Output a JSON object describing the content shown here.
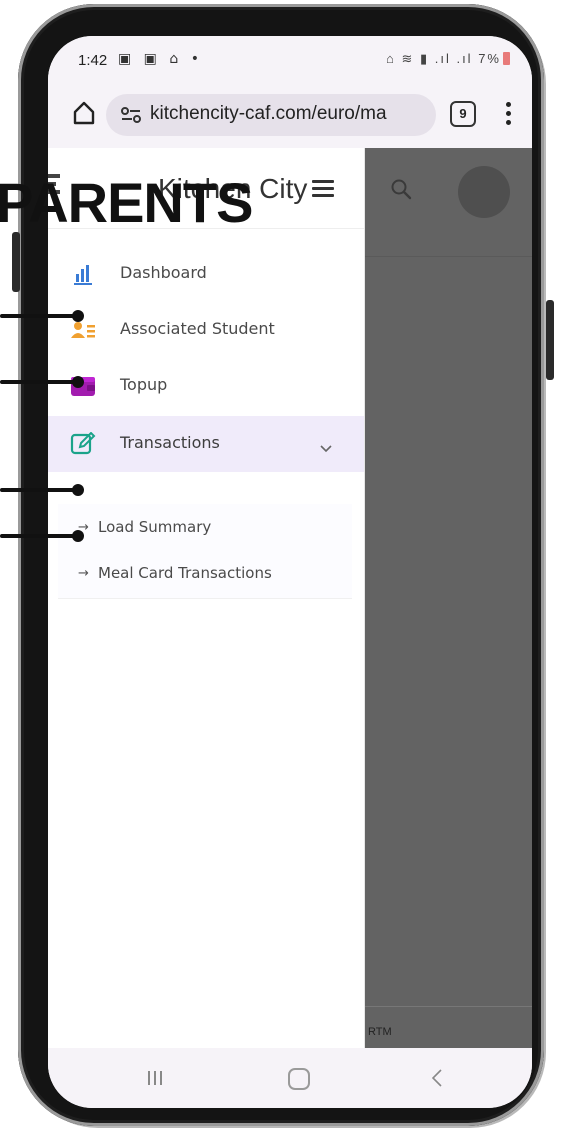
{
  "status_bar": {
    "time": "1:42",
    "left_icons": "▣ ▣ ⌂ •",
    "right_icons": "⌂ ≋ ▮ .ıl .ıl",
    "battery": "7%"
  },
  "browser": {
    "url": "kitchencity-caf.com/euro/ma",
    "tab_count": "9"
  },
  "sidebar": {
    "brand": "Kitchen City",
    "items": [
      {
        "label": "Dashboard",
        "icon": "bar-chart-icon"
      },
      {
        "label": "Associated Student",
        "icon": "id-card-icon"
      },
      {
        "label": "Topup",
        "icon": "wallet-icon"
      },
      {
        "label": "Transactions",
        "icon": "edit-icon"
      }
    ],
    "sub_items": [
      {
        "label": "Load Summary"
      },
      {
        "label": "Meal Card Transactions"
      }
    ]
  },
  "overlay": {
    "footer_text": "RTM"
  },
  "annotation": {
    "title": "PARENTS"
  },
  "colors": {
    "accent_purple": "#7b3fe4",
    "active_bg": "#f0ebfa",
    "dashboard_blue": "#3a7bd5",
    "student_orange": "#f0a030",
    "topup_magenta": "#a21caf",
    "transactions_teal": "#1ba38a"
  }
}
